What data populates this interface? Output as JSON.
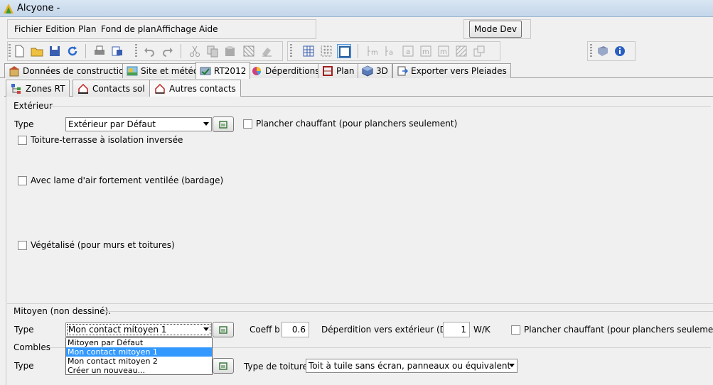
{
  "window": {
    "title": "Alcyone -"
  },
  "menu": [
    "Fichier",
    "Edition",
    "Plan",
    "Fond de plan",
    "Affichage",
    "Aide"
  ],
  "mode_button": "Mode Dev",
  "tabs": [
    {
      "label": "Données de construction",
      "icon": "building-icon"
    },
    {
      "label": "Site et météo",
      "icon": "weather-icon"
    },
    {
      "label": "RT2012",
      "icon": "rt2012-icon",
      "active": true
    },
    {
      "label": "Déperditions",
      "icon": "pie-chart-icon"
    },
    {
      "label": "Plan",
      "icon": "plan-icon"
    },
    {
      "label": "3D",
      "icon": "cube-icon"
    },
    {
      "label": "Exporter vers Pleiades",
      "icon": "export-icon"
    }
  ],
  "subtabs": [
    {
      "label": "Zones RT",
      "icon": "tree-icon"
    },
    {
      "label": "Contacts sol",
      "icon": "house-ground-icon"
    },
    {
      "label": "Autres contacts",
      "icon": "house-icon",
      "active": true
    }
  ],
  "exterieur": {
    "group_label": "Extérieur",
    "type_label": "Type",
    "type_value": "Extérieur par Défaut",
    "plancher_chauffant": "Plancher chauffant (pour planchers seulement)",
    "toiture_inversee": "Toiture-terrasse à isolation inversée",
    "lame_air": "Avec lame d'air fortement ventilée (bardage)",
    "vegetalise": "Végétalisé (pour murs et toitures)"
  },
  "mitoyen": {
    "group_label": "Mitoyen (non dessiné).",
    "type_label": "Type",
    "type_value": "Mon contact mitoyen 1",
    "coeff_label": "Coeff b",
    "coeff_value": "0.6",
    "deperdition_label": "Déperdition vers extérieur (Due)",
    "deperdition_value": "1",
    "deperdition_unit": "W/K",
    "plancher_chauffant": "Plancher chauffant (pour planchers seulement)",
    "dropdown_options": [
      "Mitoyen par Défaut",
      "Mon contact mitoyen 1",
      "Mon contact mitoyen 2",
      "Créer un nouveau..."
    ],
    "dropdown_selected_index": 1
  },
  "combles": {
    "group_label": "Combles",
    "type_label": "Type",
    "toiture_label": "Type de toiture",
    "toiture_value": "Toit à tuile sans écran, panneaux ou équivalent"
  },
  "colors": {
    "selection": "#3399ff",
    "titlebar": "#c4d6ea"
  }
}
